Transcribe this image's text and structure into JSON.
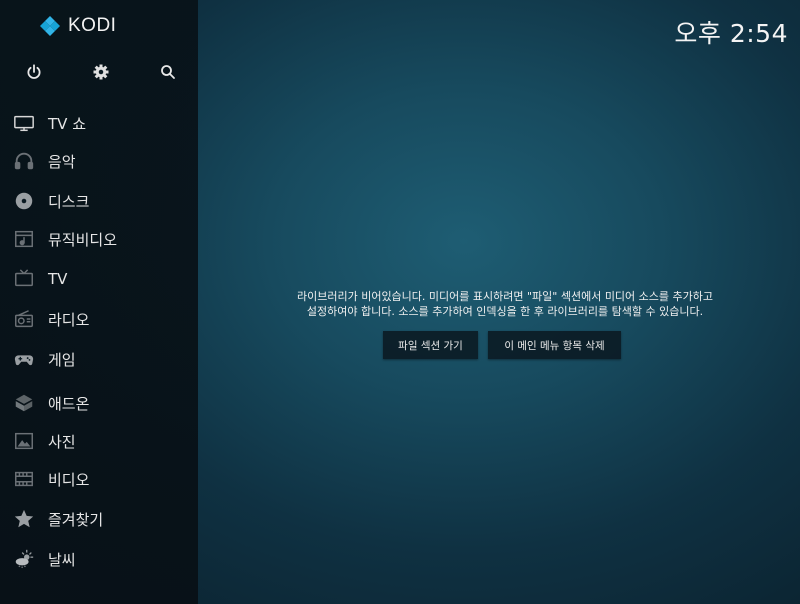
{
  "app": {
    "logo_text": "KODI",
    "clock": "오후 2:54"
  },
  "top_icons": [
    {
      "name": "power-icon"
    },
    {
      "name": "settings-icon"
    },
    {
      "name": "search-icon"
    }
  ],
  "menu": {
    "items": [
      {
        "label": "TV 쇼",
        "icon": "tv-show-icon"
      },
      {
        "label": "음악",
        "icon": "headphones-icon"
      },
      {
        "label": "디스크",
        "icon": "disc-icon"
      },
      {
        "label": "뮤직비디오",
        "icon": "music-video-icon"
      },
      {
        "label": "TV",
        "icon": "tv-icon"
      },
      {
        "label": "라디오",
        "icon": "radio-icon"
      },
      {
        "label": "게임",
        "icon": "gamepad-icon"
      },
      {
        "label": "애드온",
        "icon": "addon-box-icon"
      },
      {
        "label": "사진",
        "icon": "picture-icon"
      },
      {
        "label": "비디오",
        "icon": "film-icon"
      },
      {
        "label": "즐겨찾기",
        "icon": "star-icon"
      },
      {
        "label": "날씨",
        "icon": "weather-icon"
      }
    ]
  },
  "main": {
    "empty_line1": "라이브러리가 비어있습니다. 미디어를 표시하려면 \"파일\" 섹션에서 미디어 소스를 추가하고",
    "empty_line2": "설정하여야 합니다. 소스를 추가하여 인덱싱을 한 후 라이브러리를 탐색할 수 있습니다.",
    "files_button": "파일 섹션 가기",
    "remove_button": "이 메인 메뉴 항목 삭제"
  }
}
